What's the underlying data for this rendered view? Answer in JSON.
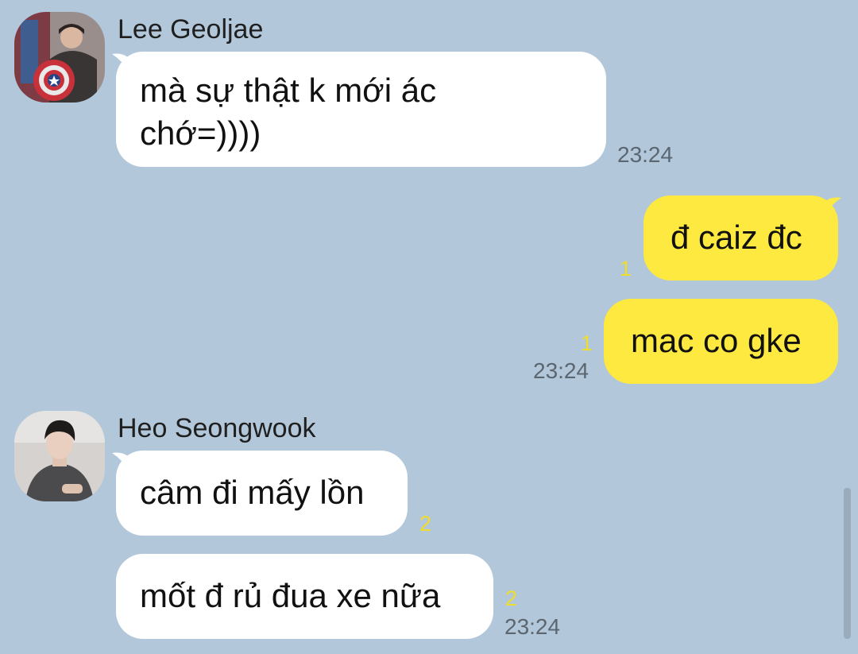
{
  "chat": {
    "groups": [
      {
        "sender": "Lee Geoljae",
        "messages": [
          {
            "lines": [
              "mà sự thật k mới ác",
              "chớ=))))"
            ],
            "time": "23:24"
          }
        ]
      },
      {
        "outgoing": [
          {
            "text": "đ caiz đc",
            "unread": "1"
          },
          {
            "text": "mac co gke",
            "unread": "1",
            "time": "23:24"
          }
        ]
      },
      {
        "sender": "Heo Seongwook",
        "messages": [
          {
            "text": "câm đi mấy lồn",
            "unread": "2"
          },
          {
            "text": "mốt đ rủ đua xe nữa",
            "unread": "2",
            "time": "23:24"
          }
        ]
      }
    ]
  },
  "colors": {
    "background": "#b2c7da",
    "incoming_bubble": "#ffffff",
    "outgoing_bubble": "#fde93f",
    "unread_count": "#f0dc2a",
    "timestamp": "#5b6670"
  }
}
